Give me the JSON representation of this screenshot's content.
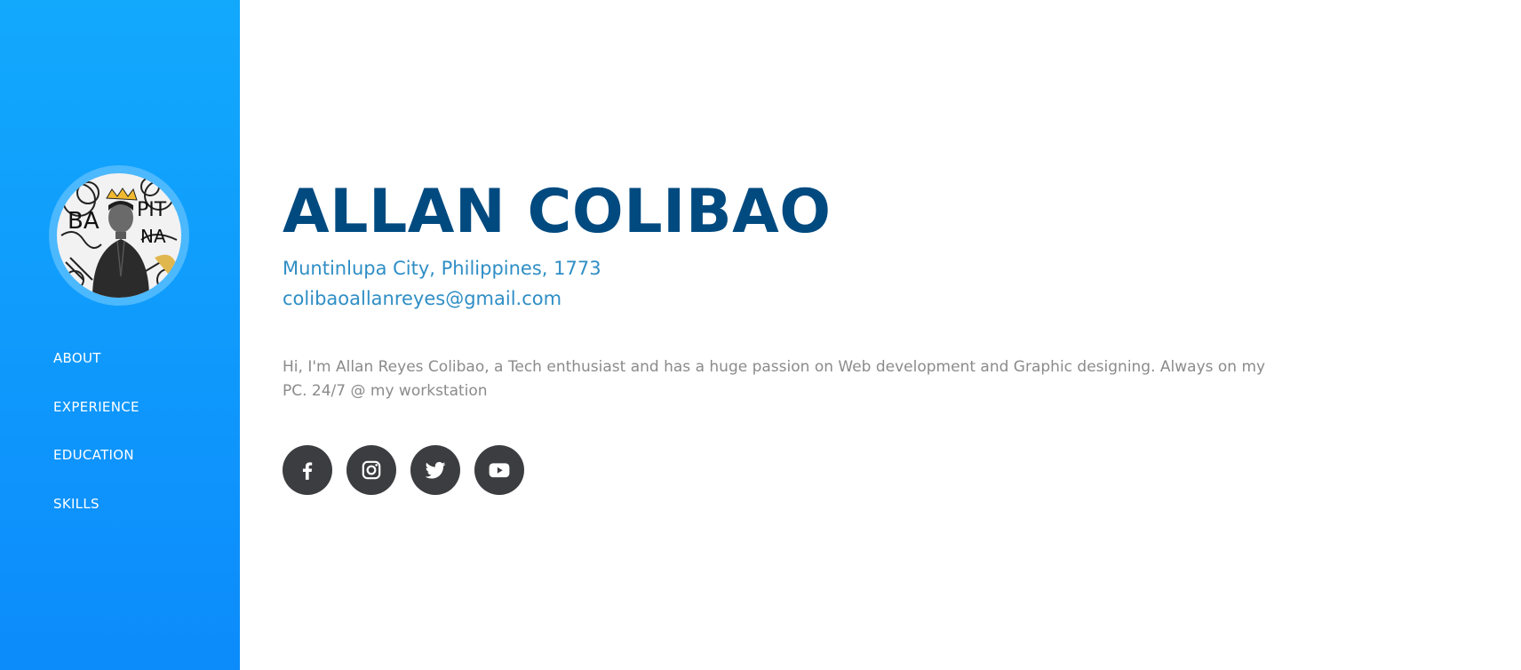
{
  "sidebar": {
    "avatar_alt": "Profile photo",
    "nav": [
      {
        "label": "ABOUT"
      },
      {
        "label": "EXPERIENCE"
      },
      {
        "label": "EDUCATION"
      },
      {
        "label": "SKILLS"
      }
    ]
  },
  "profile": {
    "name": "ALLAN COLIBAO",
    "address": "Muntinlupa City, Philippines, 1773",
    "email": "colibaoallanreyes@gmail.com",
    "bio": "Hi, I'm Allan Reyes Colibao, a Tech enthusiast and has a huge passion on Web development and Graphic designing. Always on my PC. 24/7 @ my workstation"
  },
  "social": [
    {
      "icon": "facebook-icon"
    },
    {
      "icon": "instagram-icon"
    },
    {
      "icon": "twitter-icon"
    },
    {
      "icon": "youtube-icon"
    }
  ],
  "colors": {
    "sidebar_top": "#12a9fd",
    "sidebar_bottom": "#0c8bfb",
    "name": "#004a7f",
    "contact": "#2f8ec5",
    "bio": "#8b8b8b",
    "social_bg": "#3c3d40"
  }
}
